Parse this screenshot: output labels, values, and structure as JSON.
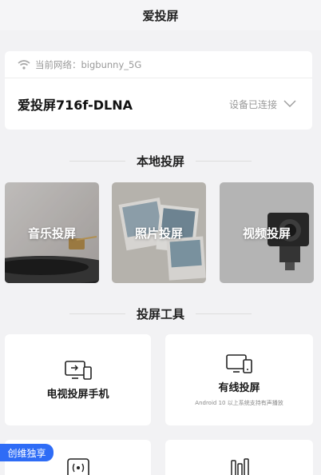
{
  "header": {
    "title": "爱投屏"
  },
  "network": {
    "label": "当前网络：",
    "ssid": "bigbunny_5G"
  },
  "device": {
    "name": "爱投屏716f-DLNA",
    "status": "设备已连接"
  },
  "local_section": {
    "title": "本地投屏",
    "tiles": [
      {
        "label": "音乐投屏"
      },
      {
        "label": "照片投屏"
      },
      {
        "label": "视频投屏"
      }
    ]
  },
  "tools_section": {
    "title": "投屏工具",
    "items": [
      {
        "label": "电视投屏手机"
      },
      {
        "label": "有线投屏",
        "sub": "Android 10 以上系统支持有声播放"
      }
    ]
  },
  "badge": {
    "label": "创维独享"
  },
  "colors": {
    "accent": "#2e6cf6",
    "background": "#f2f2f4"
  }
}
